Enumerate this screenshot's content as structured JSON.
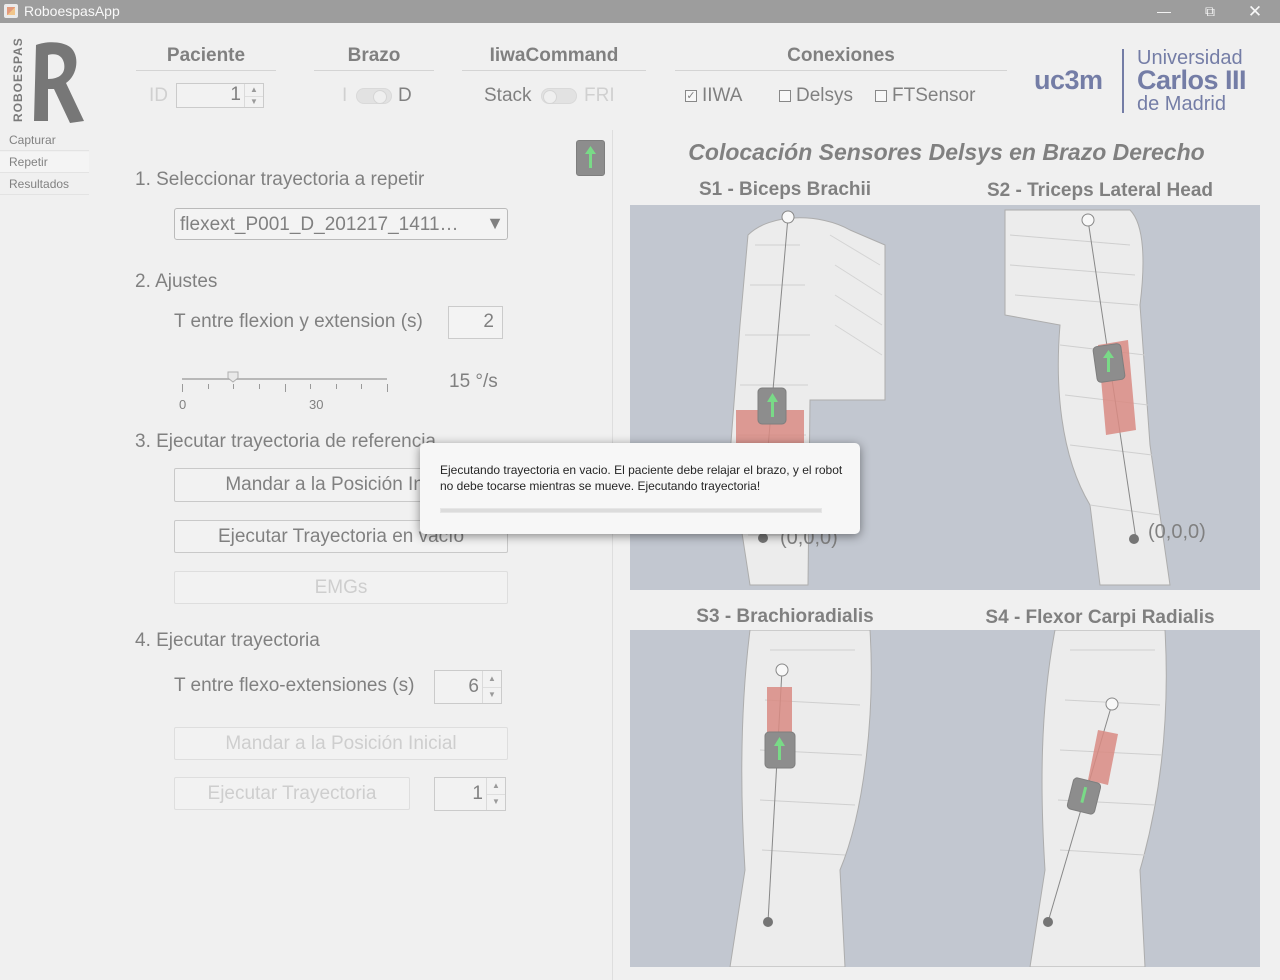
{
  "window": {
    "title": "RoboespasApp"
  },
  "header": {
    "logo_text": "ROBOESPAS",
    "paciente": {
      "title": "Paciente",
      "id_label": "ID",
      "id_value": "1"
    },
    "brazo": {
      "title": "Brazo",
      "left_label": "I",
      "right_label": "D",
      "selected": "D"
    },
    "iiwa": {
      "title": "IiwaCommand",
      "left_label": "Stack",
      "right_label": "FRI",
      "selected": "Stack"
    },
    "conexiones": {
      "title": "Conexiones",
      "items": [
        {
          "label": "IIWA",
          "checked": true
        },
        {
          "label": "Delsys",
          "checked": false
        },
        {
          "label": "FTSensor",
          "checked": false
        }
      ]
    },
    "university": {
      "short": "uc3m",
      "line1": "Universidad",
      "line2": "Carlos III",
      "line3": "de Madrid",
      "color": "#10206b"
    }
  },
  "sidebar": {
    "tabs": [
      {
        "label": "Capturar"
      },
      {
        "label": "Repetir"
      },
      {
        "label": "Resultados"
      }
    ],
    "active": "Repetir"
  },
  "left": {
    "step1": {
      "title": "1. Seleccionar trayectoria a repetir",
      "dropdown_value": "flexext_P001_D_201217_1411…"
    },
    "step2": {
      "title": "2. Ajustes",
      "t_label": "T entre flexion y extension (s)",
      "t_value": "2",
      "slider_value": 15,
      "slider_max": 60,
      "speed_label": "15 °/s",
      "tick_labels": [
        "0",
        "30"
      ]
    },
    "step3": {
      "title": "3. Ejecutar trayectoria de referencia",
      "btn_home": "Mandar a la Posición Inicial",
      "btn_run": "Ejecutar Trayectoria en vacío",
      "btn_emgs": "EMGs"
    },
    "step4": {
      "title": "4. Ejecutar trayectoria",
      "t_label": "T entre flexo-extensiones (s)",
      "t_value": "6",
      "btn_home": "Mandar a la Posición Inicial",
      "btn_run": "Ejecutar Trayectoria",
      "reps_value": "1"
    }
  },
  "right": {
    "title": "Colocación Sensores Delsys en Brazo Derecho",
    "panels": [
      {
        "title": "S1 - Biceps Brachii",
        "origin": "(0,0,0)"
      },
      {
        "title": "S2 - Triceps Lateral Head",
        "origin": "(0,0,0)"
      },
      {
        "title": "S3 - Brachioradialis"
      },
      {
        "title": "S4 - Flexor Carpi Radialis"
      }
    ]
  },
  "dialog": {
    "message": "Ejecutando trayectoria en vacio. El paciente debe relajar el brazo, y el robot no debe tocarse mientras se mueve. Ejecutando trayectoria!",
    "progress": 0
  },
  "colors": {
    "titlebar": "#5a5a5a",
    "sensor_red": "#c8382a",
    "arrow_green": "#19c832",
    "image_bg": "#9da6b6"
  }
}
